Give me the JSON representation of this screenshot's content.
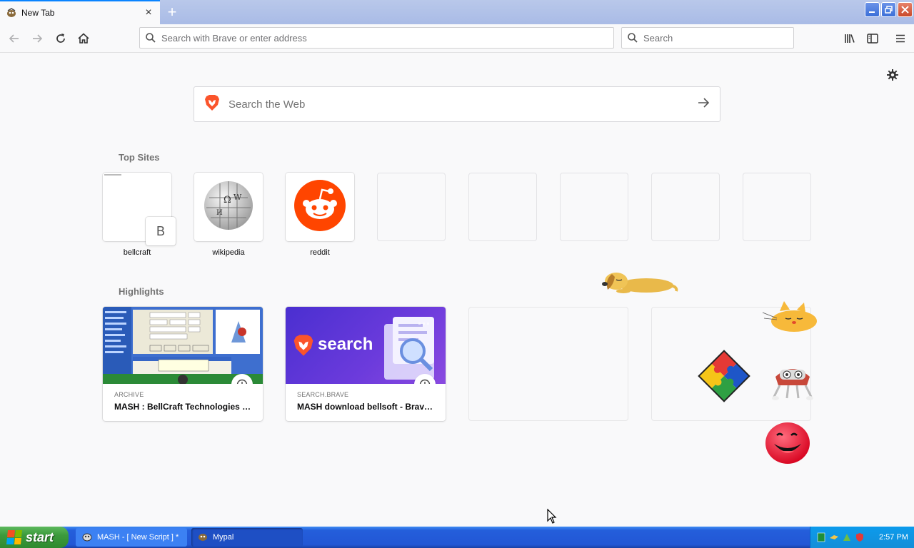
{
  "tab": {
    "title": "New Tab",
    "close_glyph": "×",
    "new_tab_glyph": "+"
  },
  "window_controls": [
    "minimize-icon",
    "restore-icon",
    "close-icon"
  ],
  "navbar": {
    "back_icon": "arrow-left-icon",
    "forward_icon": "arrow-right-icon",
    "reload_icon": "reload-icon",
    "home_icon": "home-icon",
    "address_placeholder": "Search with Brave or enter address",
    "search_placeholder": "Search",
    "library_icon": "library-icon",
    "sidebar_icon": "sidebar-icon",
    "menu_icon": "hamburger-menu-icon"
  },
  "content": {
    "web_search_placeholder": "Search the Web",
    "top_sites_title": "Top Sites",
    "top_sites": [
      {
        "label": "bellcraft",
        "badge": "B"
      },
      {
        "label": "wikipedia"
      },
      {
        "label": "reddit"
      }
    ],
    "highlights_title": "Highlights",
    "highlights": [
      {
        "source": "ARCHIVE",
        "title": "MASH : BellCraft Technologies : ..."
      },
      {
        "source": "SEARCH.BRAVE",
        "title": "MASH download bellsoft - Brave...",
        "thumb_text": "search"
      }
    ]
  },
  "colors": {
    "brave_orange": "#fb542b",
    "reddit_orange": "#ff4500",
    "brave_purple": "#5b3fd9",
    "accent_blue": "#0a84ff"
  },
  "taskbar": {
    "start_label": "start",
    "items": [
      {
        "label": "MASH - [ New Script ] *",
        "icon": "mash-icon"
      },
      {
        "label": "Mypal",
        "icon": "mypal-icon"
      }
    ],
    "clock": "2:57 PM"
  }
}
